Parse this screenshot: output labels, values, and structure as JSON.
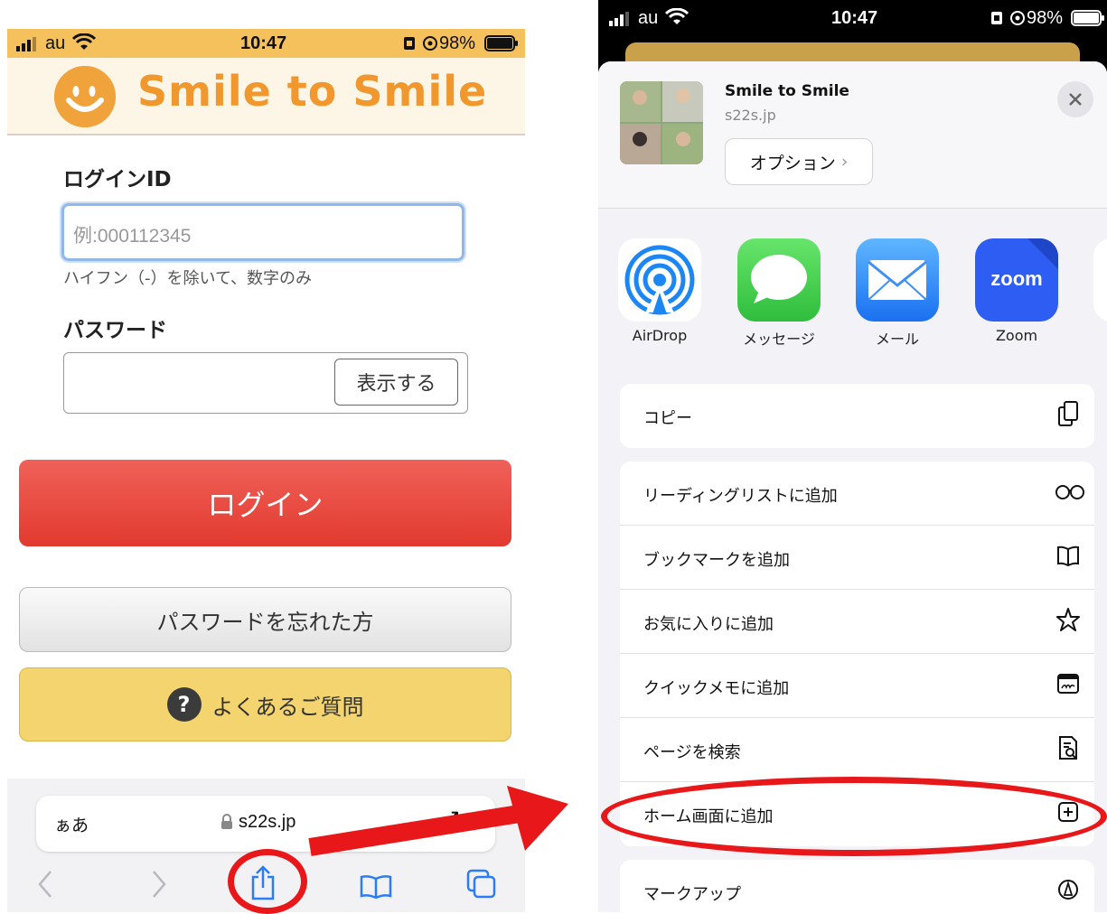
{
  "status_bar": {
    "carrier": "au",
    "time": "10:47",
    "battery": "98%"
  },
  "left": {
    "logo_text": "Smile to Smile",
    "login_id_label": "ログインID",
    "login_id_placeholder": "例:000112345",
    "login_id_hint": "ハイフン（-）を除いて、数字のみ",
    "password_label": "パスワード",
    "show_button": "表示する",
    "login_button": "ログイン",
    "forgot_button": "パスワードを忘れた方",
    "faq_button": "よくあるご質問",
    "faq_icon_glyph": "?",
    "address_bar": {
      "aa": "ぁあ",
      "url": "s22s.jp"
    },
    "toolbar_icons": [
      "back-icon",
      "forward-icon",
      "share-icon",
      "bookmarks-icon",
      "tabs-icon"
    ]
  },
  "right": {
    "share_title": "Smile to Smile",
    "share_url": "s22s.jp",
    "options_button": "オプション",
    "apps": [
      {
        "label": "AirDrop",
        "icon": "airdrop-icon"
      },
      {
        "label": "メッセージ",
        "icon": "messages-icon"
      },
      {
        "label": "メール",
        "icon": "mail-icon"
      },
      {
        "label": "Zoom",
        "icon": "zoom-icon"
      }
    ],
    "zoom_icon_text": "zoom",
    "copy_action": "コピー",
    "actions": [
      {
        "label": "リーディングリストに追加",
        "icon": "glasses-icon"
      },
      {
        "label": "ブックマークを追加",
        "icon": "book-icon"
      },
      {
        "label": "お気に入りに追加",
        "icon": "star-icon"
      },
      {
        "label": "クイックメモに追加",
        "icon": "quick-note-icon"
      },
      {
        "label": "ページを検索",
        "icon": "find-on-page-icon"
      },
      {
        "label": "ホーム画面に追加",
        "icon": "add-square-icon"
      }
    ],
    "markup_action": "マークアップ"
  },
  "colors": {
    "annotation_red": "#e8171a",
    "ios_blue": "#2c7cf6",
    "login_red": "#e8443a",
    "faq_yellow": "#f4d46e",
    "logo_orange": "#f0982d"
  }
}
